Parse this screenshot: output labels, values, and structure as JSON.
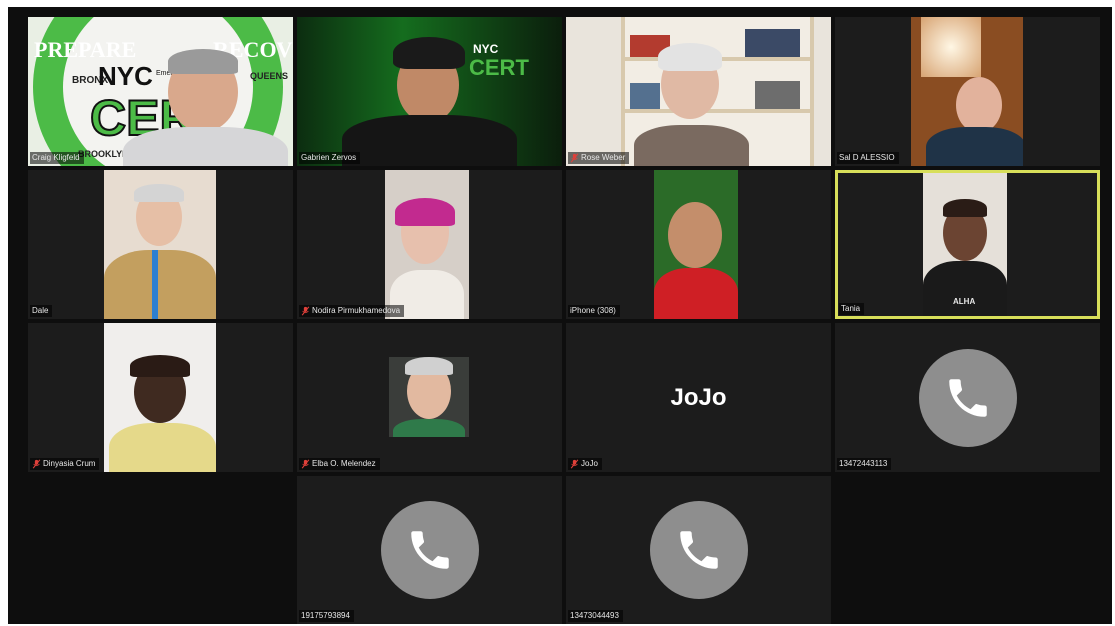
{
  "participants": [
    {
      "name": "Craig Kligfeld",
      "muted": false
    },
    {
      "name": "Gabrien Zervos",
      "muted": false
    },
    {
      "name": "Rose Weber",
      "muted": true
    },
    {
      "name": "Sal D ALESSIO",
      "muted": false
    },
    {
      "name": "Dale",
      "muted": false
    },
    {
      "name": "Nodira Pirmukhamedova",
      "muted": true
    },
    {
      "name": "iPhone (308)",
      "muted": false
    },
    {
      "name": "Tania",
      "muted": false,
      "active_speaker": true
    },
    {
      "name": "Dinyasia Crum",
      "muted": true
    },
    {
      "name": "Elba O. Melendez",
      "muted": true
    },
    {
      "name": "JoJo",
      "muted": true,
      "avatar_text": "JoJo"
    },
    {
      "name": "13472443113",
      "muted": false,
      "phone_user": true
    },
    {
      "name": "19175793894",
      "muted": false,
      "phone_user": true
    },
    {
      "name": "13473044493",
      "muted": false,
      "phone_user": true
    }
  ],
  "backgrounds": {
    "cert_logo_text": "CERT",
    "nyc_text": "NYC",
    "banner_left": "PREPARE",
    "banner_right": "RECOVER.",
    "borough_left": "BRONX",
    "borough_right": "QUEENS",
    "borough_bottom": "BROOKLYN",
    "nyc_em_small": "Emergency Management",
    "shirt_text": "ALHA"
  },
  "colors": {
    "active_speaker_border": "#d8df5a",
    "tile_bg": "#1c1c1c",
    "stage_bg": "#0e0e0e",
    "phone_circle": "#8e8e8e",
    "mute_icon": "#e0403a",
    "cert_green": "#4cbb47"
  },
  "icons": {
    "mute": "microphone-muted-icon",
    "phone": "phone-handset-icon"
  }
}
